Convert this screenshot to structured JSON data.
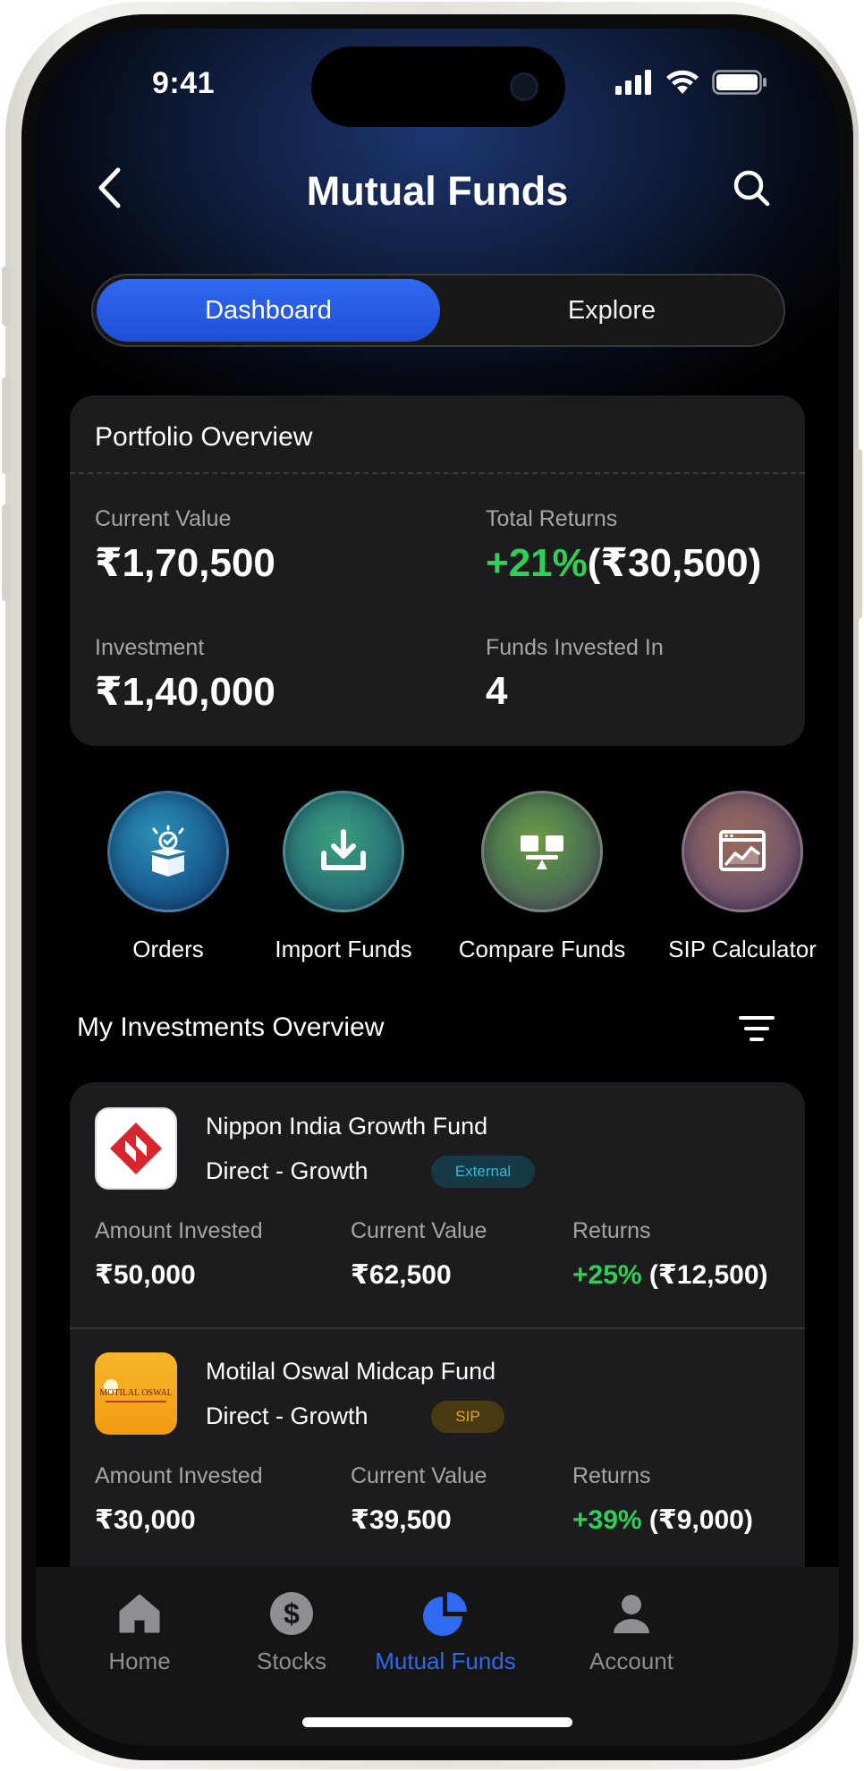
{
  "status_bar": {
    "time": "9:41"
  },
  "header": {
    "title": "Mutual Funds"
  },
  "segments": {
    "active": "Dashboard",
    "inactive": "Explore"
  },
  "portfolio": {
    "title": "Portfolio Overview",
    "current_value_label": "Current Value",
    "current_value": "₹1,70,500",
    "total_returns_label": "Total Returns",
    "total_returns_pct": "+21%",
    "total_returns_amt": "(₹30,500)",
    "investment_label": "Investment",
    "investment": "₹1,40,000",
    "funds_label": "Funds Invested In",
    "funds_count": "4"
  },
  "quick_actions": [
    {
      "label": "Orders",
      "icon": "box-check-icon"
    },
    {
      "label": "Import Funds",
      "icon": "download-tray-icon"
    },
    {
      "label": "Compare Funds",
      "icon": "compare-scale-icon"
    },
    {
      "label": "SIP Calculator",
      "icon": "chart-calculator-icon"
    }
  ],
  "investments": {
    "title": "My Investments Overview",
    "items": [
      {
        "name": "Nippon India Growth Fund",
        "plan": "Direct - Growth",
        "badge": "External",
        "amount_label": "Amount Invested",
        "amount": "₹50,000",
        "current_label": "Current Value",
        "current": "₹62,500",
        "returns_label": "Returns",
        "returns_pct": "+25%",
        "returns_amt": "(₹12,500)"
      },
      {
        "name": "Motilal Oswal Midcap Fund",
        "logo_text": "MOTILAL OSWAL",
        "plan": "Direct - Growth",
        "badge": "SIP",
        "amount_label": "Amount Invested",
        "amount": "₹30,000",
        "current_label": "Current Value",
        "current": "₹39,500",
        "returns_label": "Returns",
        "returns_pct": "+39%",
        "returns_amt": "(₹9,000)"
      }
    ]
  },
  "nav": {
    "home": "Home",
    "stocks": "Stocks",
    "mutual_funds": "Mutual Funds",
    "account": "Account"
  },
  "colors": {
    "accent": "#2f6af0",
    "positive": "#2fd05a",
    "card": "#1c1c1e",
    "external_badge": "#36b8d6",
    "sip_badge": "#e0a91c"
  }
}
